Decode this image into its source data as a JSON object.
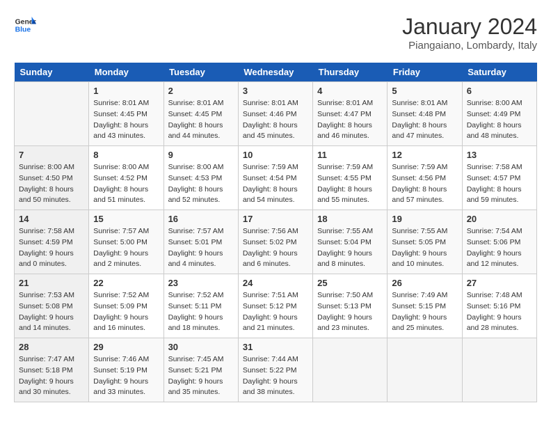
{
  "header": {
    "logo_line1": "General",
    "logo_line2": "Blue",
    "month": "January 2024",
    "location": "Piangaiano, Lombardy, Italy"
  },
  "days_of_week": [
    "Sunday",
    "Monday",
    "Tuesday",
    "Wednesday",
    "Thursday",
    "Friday",
    "Saturday"
  ],
  "weeks": [
    [
      {
        "day": "",
        "sunrise": "",
        "sunset": "",
        "daylight": ""
      },
      {
        "day": "1",
        "sunrise": "Sunrise: 8:01 AM",
        "sunset": "Sunset: 4:45 PM",
        "daylight": "Daylight: 8 hours and 43 minutes."
      },
      {
        "day": "2",
        "sunrise": "Sunrise: 8:01 AM",
        "sunset": "Sunset: 4:45 PM",
        "daylight": "Daylight: 8 hours and 44 minutes."
      },
      {
        "day": "3",
        "sunrise": "Sunrise: 8:01 AM",
        "sunset": "Sunset: 4:46 PM",
        "daylight": "Daylight: 8 hours and 45 minutes."
      },
      {
        "day": "4",
        "sunrise": "Sunrise: 8:01 AM",
        "sunset": "Sunset: 4:47 PM",
        "daylight": "Daylight: 8 hours and 46 minutes."
      },
      {
        "day": "5",
        "sunrise": "Sunrise: 8:01 AM",
        "sunset": "Sunset: 4:48 PM",
        "daylight": "Daylight: 8 hours and 47 minutes."
      },
      {
        "day": "6",
        "sunrise": "Sunrise: 8:00 AM",
        "sunset": "Sunset: 4:49 PM",
        "daylight": "Daylight: 8 hours and 48 minutes."
      }
    ],
    [
      {
        "day": "7",
        "sunrise": "Sunrise: 8:00 AM",
        "sunset": "Sunset: 4:50 PM",
        "daylight": "Daylight: 8 hours and 50 minutes."
      },
      {
        "day": "8",
        "sunrise": "Sunrise: 8:00 AM",
        "sunset": "Sunset: 4:52 PM",
        "daylight": "Daylight: 8 hours and 51 minutes."
      },
      {
        "day": "9",
        "sunrise": "Sunrise: 8:00 AM",
        "sunset": "Sunset: 4:53 PM",
        "daylight": "Daylight: 8 hours and 52 minutes."
      },
      {
        "day": "10",
        "sunrise": "Sunrise: 7:59 AM",
        "sunset": "Sunset: 4:54 PM",
        "daylight": "Daylight: 8 hours and 54 minutes."
      },
      {
        "day": "11",
        "sunrise": "Sunrise: 7:59 AM",
        "sunset": "Sunset: 4:55 PM",
        "daylight": "Daylight: 8 hours and 55 minutes."
      },
      {
        "day": "12",
        "sunrise": "Sunrise: 7:59 AM",
        "sunset": "Sunset: 4:56 PM",
        "daylight": "Daylight: 8 hours and 57 minutes."
      },
      {
        "day": "13",
        "sunrise": "Sunrise: 7:58 AM",
        "sunset": "Sunset: 4:57 PM",
        "daylight": "Daylight: 8 hours and 59 minutes."
      }
    ],
    [
      {
        "day": "14",
        "sunrise": "Sunrise: 7:58 AM",
        "sunset": "Sunset: 4:59 PM",
        "daylight": "Daylight: 9 hours and 0 minutes."
      },
      {
        "day": "15",
        "sunrise": "Sunrise: 7:57 AM",
        "sunset": "Sunset: 5:00 PM",
        "daylight": "Daylight: 9 hours and 2 minutes."
      },
      {
        "day": "16",
        "sunrise": "Sunrise: 7:57 AM",
        "sunset": "Sunset: 5:01 PM",
        "daylight": "Daylight: 9 hours and 4 minutes."
      },
      {
        "day": "17",
        "sunrise": "Sunrise: 7:56 AM",
        "sunset": "Sunset: 5:02 PM",
        "daylight": "Daylight: 9 hours and 6 minutes."
      },
      {
        "day": "18",
        "sunrise": "Sunrise: 7:55 AM",
        "sunset": "Sunset: 5:04 PM",
        "daylight": "Daylight: 9 hours and 8 minutes."
      },
      {
        "day": "19",
        "sunrise": "Sunrise: 7:55 AM",
        "sunset": "Sunset: 5:05 PM",
        "daylight": "Daylight: 9 hours and 10 minutes."
      },
      {
        "day": "20",
        "sunrise": "Sunrise: 7:54 AM",
        "sunset": "Sunset: 5:06 PM",
        "daylight": "Daylight: 9 hours and 12 minutes."
      }
    ],
    [
      {
        "day": "21",
        "sunrise": "Sunrise: 7:53 AM",
        "sunset": "Sunset: 5:08 PM",
        "daylight": "Daylight: 9 hours and 14 minutes."
      },
      {
        "day": "22",
        "sunrise": "Sunrise: 7:52 AM",
        "sunset": "Sunset: 5:09 PM",
        "daylight": "Daylight: 9 hours and 16 minutes."
      },
      {
        "day": "23",
        "sunrise": "Sunrise: 7:52 AM",
        "sunset": "Sunset: 5:11 PM",
        "daylight": "Daylight: 9 hours and 18 minutes."
      },
      {
        "day": "24",
        "sunrise": "Sunrise: 7:51 AM",
        "sunset": "Sunset: 5:12 PM",
        "daylight": "Daylight: 9 hours and 21 minutes."
      },
      {
        "day": "25",
        "sunrise": "Sunrise: 7:50 AM",
        "sunset": "Sunset: 5:13 PM",
        "daylight": "Daylight: 9 hours and 23 minutes."
      },
      {
        "day": "26",
        "sunrise": "Sunrise: 7:49 AM",
        "sunset": "Sunset: 5:15 PM",
        "daylight": "Daylight: 9 hours and 25 minutes."
      },
      {
        "day": "27",
        "sunrise": "Sunrise: 7:48 AM",
        "sunset": "Sunset: 5:16 PM",
        "daylight": "Daylight: 9 hours and 28 minutes."
      }
    ],
    [
      {
        "day": "28",
        "sunrise": "Sunrise: 7:47 AM",
        "sunset": "Sunset: 5:18 PM",
        "daylight": "Daylight: 9 hours and 30 minutes."
      },
      {
        "day": "29",
        "sunrise": "Sunrise: 7:46 AM",
        "sunset": "Sunset: 5:19 PM",
        "daylight": "Daylight: 9 hours and 33 minutes."
      },
      {
        "day": "30",
        "sunrise": "Sunrise: 7:45 AM",
        "sunset": "Sunset: 5:21 PM",
        "daylight": "Daylight: 9 hours and 35 minutes."
      },
      {
        "day": "31",
        "sunrise": "Sunrise: 7:44 AM",
        "sunset": "Sunset: 5:22 PM",
        "daylight": "Daylight: 9 hours and 38 minutes."
      },
      {
        "day": "",
        "sunrise": "",
        "sunset": "",
        "daylight": ""
      },
      {
        "day": "",
        "sunrise": "",
        "sunset": "",
        "daylight": ""
      },
      {
        "day": "",
        "sunrise": "",
        "sunset": "",
        "daylight": ""
      }
    ]
  ]
}
